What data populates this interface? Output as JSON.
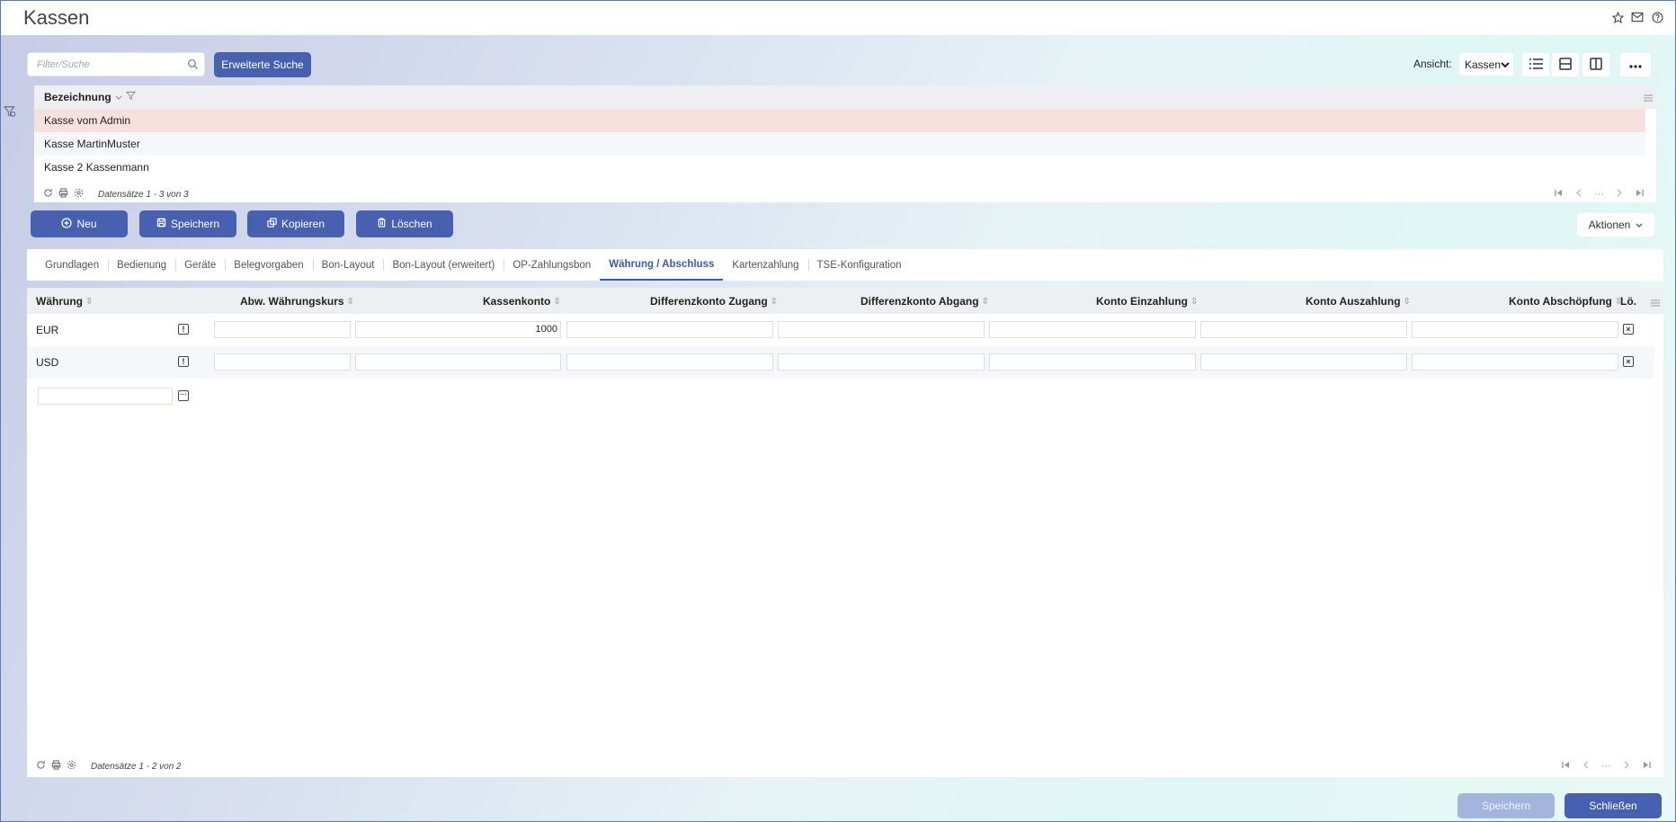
{
  "window": {
    "title": "Kassen"
  },
  "title_icons": [
    "star-icon",
    "mail-icon",
    "help-icon"
  ],
  "search": {
    "placeholder": "Filter/Suche",
    "value": "",
    "ext_label": "Erweiterte Suche"
  },
  "view": {
    "label": "Ansicht:",
    "selected": "Kassen"
  },
  "list": {
    "column": "Bezeichnung",
    "rows": [
      "Kasse vom Admin",
      "Kasse MartinMuster",
      "Kasse 2 Kassenmann"
    ],
    "selected_index": 0,
    "record_info": "Datensätze 1 - 3 von 3"
  },
  "actions": {
    "new": "Neu",
    "save": "Speichern",
    "copy": "Kopieren",
    "delete": "Löschen",
    "more": "Aktionen"
  },
  "tabs": [
    "Grundlagen",
    "Bedienung",
    "Geräte",
    "Belegvorgaben",
    "Bon-Layout",
    "Bon-Layout (erweitert)",
    "OP-Zahlungsbon",
    "Währung / Abschluss",
    "Kartenzahlung",
    "TSE-Konfiguration"
  ],
  "active_tab": "Währung / Abschluss",
  "grid": {
    "columns": {
      "currency": "Währung",
      "rate": "Abw. Währungskurs",
      "cash_account": "Kassenkonto",
      "diff_in": "Differenzkonto Zugang",
      "diff_out": "Differenzkonto Abgang",
      "deposit": "Konto Einzahlung",
      "payout": "Konto Auszahlung",
      "skim": "Konto Abschöpfung",
      "delete": "Lö."
    },
    "rows": [
      {
        "currency": "EUR",
        "rate": "",
        "cash_account": "1000",
        "diff_in": "",
        "diff_out": "",
        "deposit": "",
        "payout": "",
        "skim": ""
      },
      {
        "currency": "USD",
        "rate": "",
        "cash_account": "",
        "diff_in": "",
        "diff_out": "",
        "deposit": "",
        "payout": "",
        "skim": ""
      }
    ],
    "record_info": "Datensätze 1 - 2 von 2"
  },
  "footer": {
    "save": "Speichern",
    "close": "Schließen"
  }
}
